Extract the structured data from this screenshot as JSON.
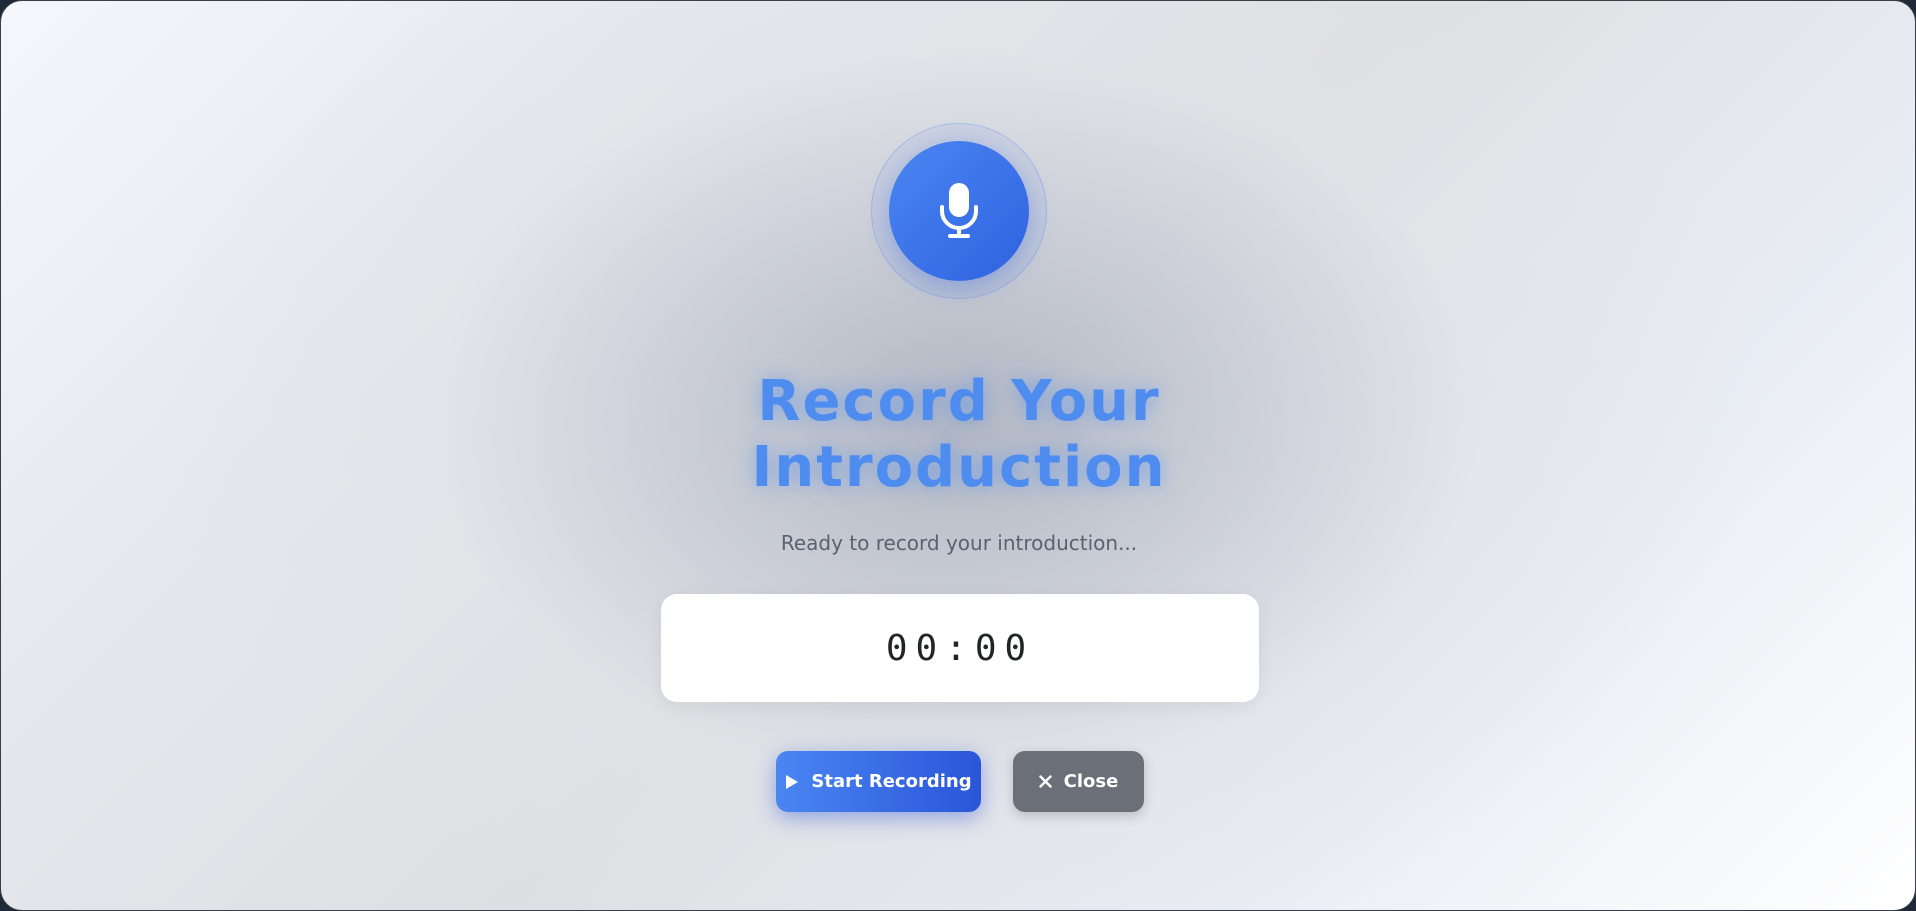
{
  "recorder": {
    "title": "Record Your Introduction",
    "status_text": "Ready to record your introduction...",
    "timer": "00:00",
    "mic_icon": "microphone-icon",
    "accent_color": "#3b78ee"
  },
  "actions": {
    "start_label": "Start Recording",
    "start_icon": "play-icon",
    "close_label": "Close",
    "close_icon": "close-icon",
    "close_color": "#6b7078"
  }
}
